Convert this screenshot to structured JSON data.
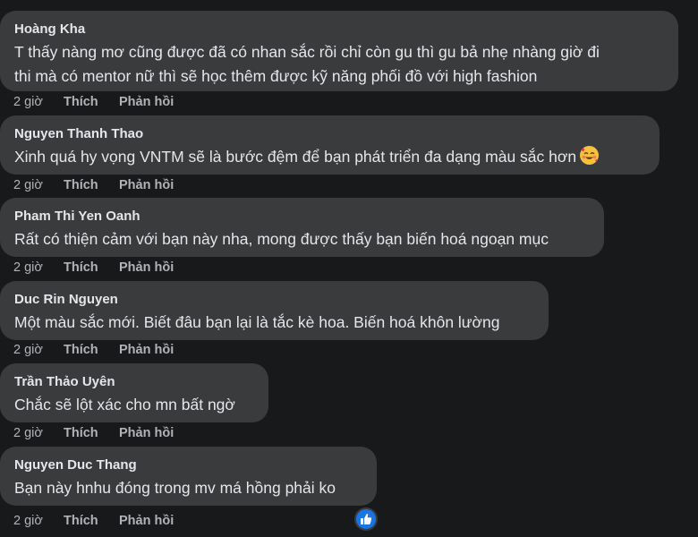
{
  "comments": [
    {
      "author": "Hoàng Kha",
      "lines": [
        "T thấy nàng mơ cũng được đã có nhan sắc rồi chỉ còn gu thì gu bả nhẹ nhàng giờ đi",
        "thi mà có mentor nữ thì sẽ học thêm được kỹ năng phối đồ với high fashion"
      ],
      "time": "2 giờ",
      "like_label": "Thích",
      "reply_label": "Phản hồi"
    },
    {
      "author": "Nguyen Thanh Thao",
      "lines": [
        "Xinh quá hy vọng VNTM sẽ là bước đệm để bạn phát triển đa dạng màu sắc hơn"
      ],
      "emoji": "smiling-face-with-hearts-icon",
      "time": "2 giờ",
      "like_label": "Thích",
      "reply_label": "Phản hồi"
    },
    {
      "author": "Pham Thi Yen Oanh",
      "lines": [
        "Rất có thiện cảm với bạn này nha, mong được thấy bạn biến hoá ngoạn mục"
      ],
      "time": "2 giờ",
      "like_label": "Thích",
      "reply_label": "Phản hồi"
    },
    {
      "author": "Duc Rin Nguyen",
      "lines": [
        "Một màu sắc mới. Biết đâu bạn lại là tắc kè hoa. Biến hoá khôn lường"
      ],
      "time": "2 giờ",
      "like_label": "Thích",
      "reply_label": "Phản hồi"
    },
    {
      "author": "Trần Thảo Uyên",
      "lines": [
        "Chắc sẽ lột xác cho mn bất ngờ"
      ],
      "time": "2 giờ",
      "like_label": "Thích",
      "reply_label": "Phản hồi"
    },
    {
      "author": "Nguyen Duc Thang",
      "lines": [
        "Bạn này hnhu đóng trong mv má hồng phải ko"
      ],
      "time": "2 giờ",
      "like_label": "Thích",
      "reply_label": "Phản hồi",
      "reaction": "like-icon"
    }
  ],
  "colors": {
    "background": "#18191a",
    "bubble": "#3a3b3c",
    "text": "#e4e6eb",
    "secondary_text": "#b0b3b8",
    "like_blue": "#1b74e4"
  }
}
